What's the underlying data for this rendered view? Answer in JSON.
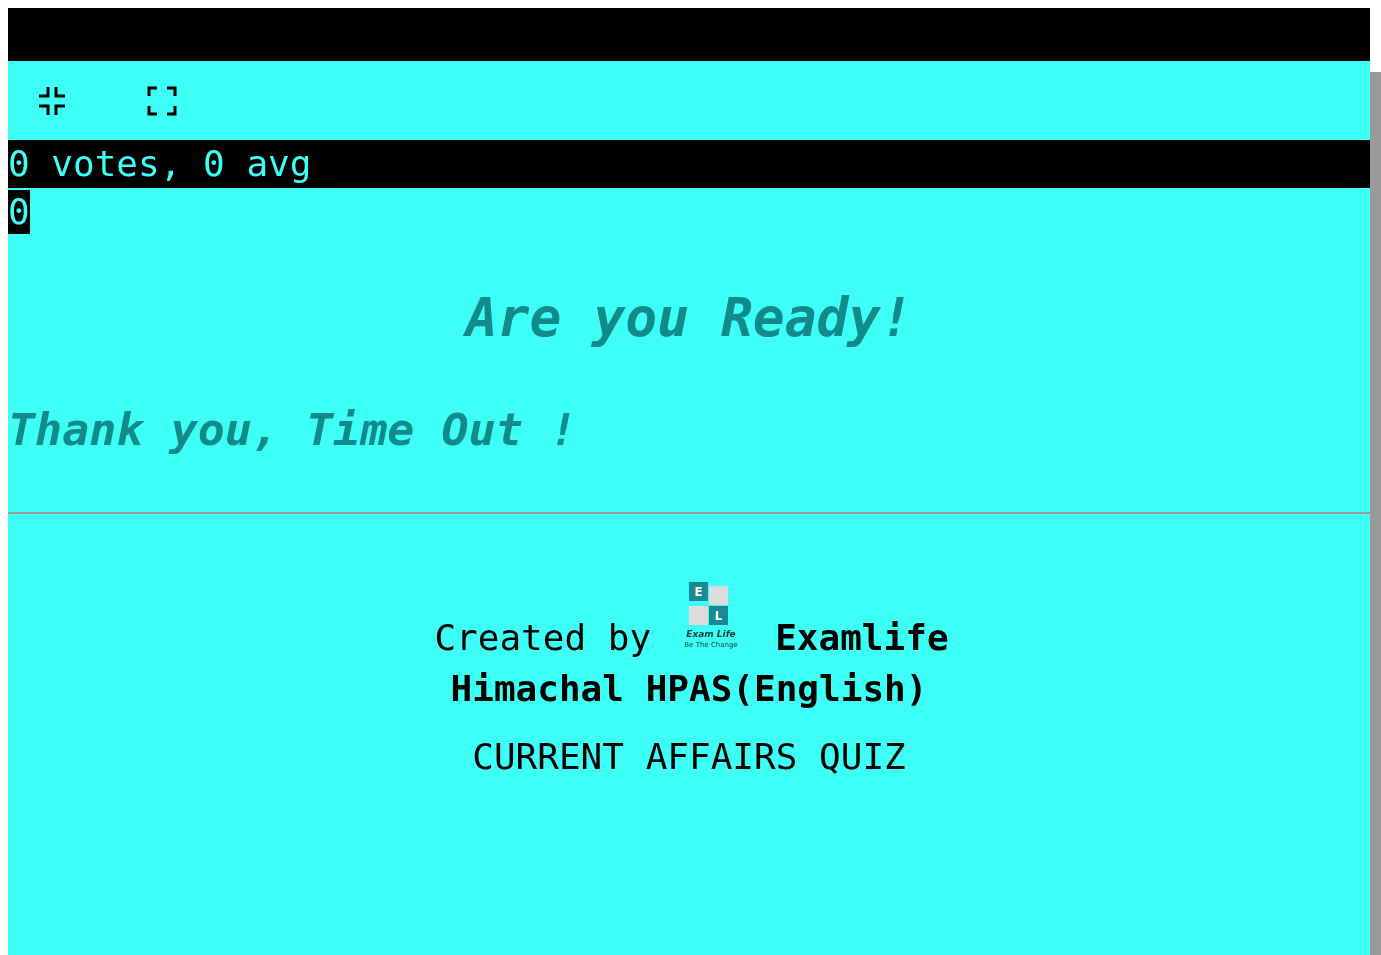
{
  "rating": {
    "summary": "0 votes, 0 avg",
    "count": "0"
  },
  "heading": "Are you Ready!",
  "message": "Thank you, Time Out !",
  "footer": {
    "created_by": "Created by",
    "logo": {
      "tile_top": "E",
      "tile_bottom": "L",
      "name": "Exam Life",
      "tagline": "Be The Change"
    },
    "brand": "Examlife",
    "subtitle": "Himachal HPAS(English)",
    "quiz_title": "CURRENT AFFAIRS QUIZ"
  }
}
